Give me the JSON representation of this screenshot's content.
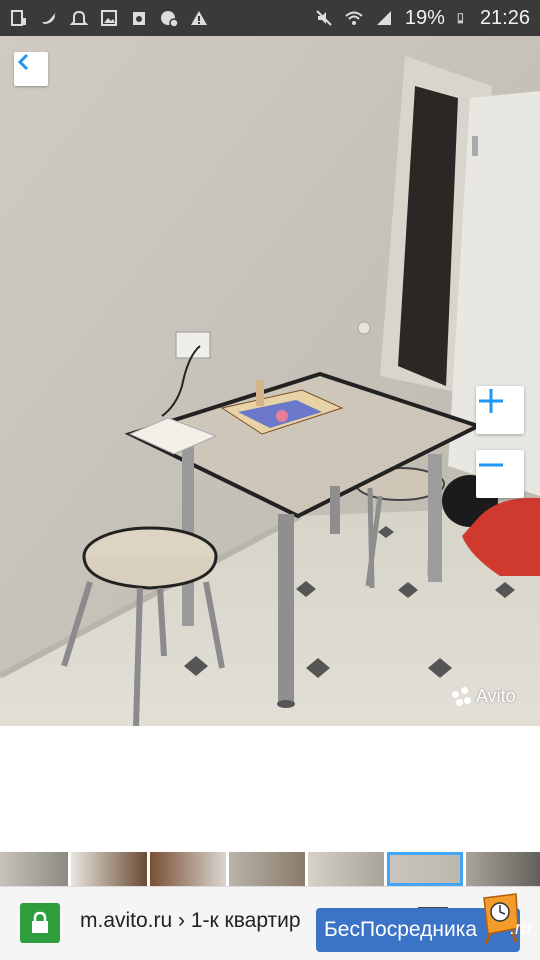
{
  "status_bar": {
    "left_icons": [
      "notification-icon",
      "twitter-icon",
      "bell-icon",
      "image-icon",
      "recycle-icon",
      "settings-alert-icon",
      "warning-icon"
    ],
    "right_icons": [
      "mute-icon",
      "wifi-icon",
      "signal-icon",
      "battery-icon"
    ],
    "battery": "19%",
    "time": "21:26"
  },
  "viewer": {
    "back_icon": "chevron-left-icon",
    "zoom_in_icon": "plus-icon",
    "zoom_out_icon": "minus-icon",
    "watermark": "Avito",
    "thumbnails_count": 7,
    "active_thumbnail_index": 5
  },
  "browser": {
    "url": "m.avito.ru › 1-к квартир",
    "lock_icon": "lock-icon",
    "tabs_icon": "tabs-icon"
  },
  "badge": {
    "text": "БесПосредника",
    "suffix": ".ru"
  },
  "colors": {
    "accent": "#42a5f5",
    "lock_green": "#2e9e3e",
    "badge_blue": "#3b73c7",
    "status_bar": "#3a3a3a"
  }
}
